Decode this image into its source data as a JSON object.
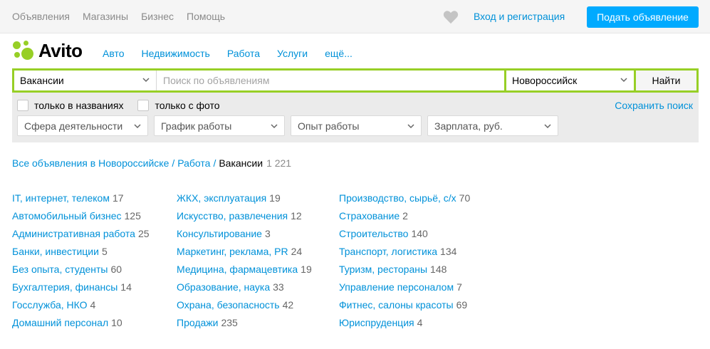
{
  "topbar": {
    "nav": [
      "Объявления",
      "Магазины",
      "Бизнес",
      "Помощь"
    ],
    "login": "Вход и регистрация",
    "post_button": "Подать объявление"
  },
  "logo": {
    "text": "Avito"
  },
  "mainnav": [
    "Авто",
    "Недвижимость",
    "Работа",
    "Услуги",
    "ещё..."
  ],
  "search": {
    "category": "Вакансии",
    "placeholder": "Поиск по объявлениям",
    "city": "Новороссийск",
    "find_button": "Найти",
    "only_titles": "только в названиях",
    "with_photo": "только с фото",
    "save_search": "Сохранить поиск",
    "filters": [
      "Сфера деятельности",
      "График работы",
      "Опыт работы",
      "Зарплата, руб."
    ]
  },
  "breadcrumb": {
    "items": [
      "Все объявления в Новороссийске",
      "Работа"
    ],
    "current": "Вакансии",
    "count": "1 221"
  },
  "categories": [
    [
      {
        "name": "IT, интернет, телеком",
        "count": "17"
      },
      {
        "name": "Автомобильный бизнес",
        "count": "125"
      },
      {
        "name": "Административная работа",
        "count": "25"
      },
      {
        "name": "Банки, инвестиции",
        "count": "5"
      },
      {
        "name": "Без опыта, студенты",
        "count": "60"
      },
      {
        "name": "Бухгалтерия, финансы",
        "count": "14"
      },
      {
        "name": "Госслужба, НКО",
        "count": "4"
      },
      {
        "name": "Домашний персонал",
        "count": "10"
      }
    ],
    [
      {
        "name": "ЖКХ, эксплуатация",
        "count": "19"
      },
      {
        "name": "Искусство, развлечения",
        "count": "12"
      },
      {
        "name": "Консультирование",
        "count": "3"
      },
      {
        "name": "Маркетинг, реклама, PR",
        "count": "24"
      },
      {
        "name": "Медицина, фармацевтика",
        "count": "19"
      },
      {
        "name": "Образование, наука",
        "count": "33"
      },
      {
        "name": "Охрана, безопасность",
        "count": "42"
      },
      {
        "name": "Продажи",
        "count": "235"
      }
    ],
    [
      {
        "name": "Производство, сырьё, с/х",
        "count": "70"
      },
      {
        "name": "Страхование",
        "count": "2"
      },
      {
        "name": "Строительство",
        "count": "140"
      },
      {
        "name": "Транспорт, логистика",
        "count": "134"
      },
      {
        "name": "Туризм, рестораны",
        "count": "148"
      },
      {
        "name": "Управление персоналом",
        "count": "7"
      },
      {
        "name": "Фитнес, салоны красоты",
        "count": "69"
      },
      {
        "name": "Юриспруденция",
        "count": "4"
      }
    ]
  ],
  "colors": {
    "accent": "#97cf26",
    "link": "#0091d9",
    "button": "#00aaff"
  }
}
